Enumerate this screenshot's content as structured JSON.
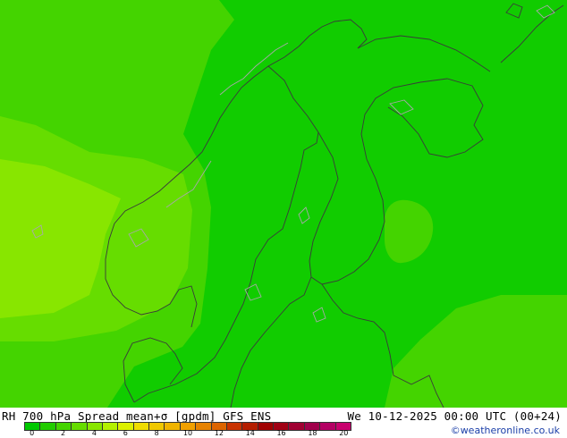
{
  "map": {
    "region": "Scandinavia",
    "background_color": "#11cc00",
    "field_colors": {
      "base": "#11cc00",
      "band_1": "#44d400",
      "band_2": "#66dd00",
      "band_3": "#88e600"
    },
    "coastline_color": "#3a3a3a",
    "lakes_color": "#a8a8a8"
  },
  "footer": {
    "title_left": "RH 700 hPa Spread mean+σ [gpdm] GFS ENS",
    "title_right": "We 10-12-2025 00:00 UTC (00+24)",
    "credit": "©weatheronline.co.uk"
  },
  "legend": {
    "colors": [
      "#00c800",
      "#22cc00",
      "#44d400",
      "#66dd00",
      "#88e600",
      "#b4f000",
      "#dcf000",
      "#f0dc00",
      "#f0c800",
      "#f0b400",
      "#f0a000",
      "#e68200",
      "#dc6400",
      "#c83200",
      "#b41e00",
      "#a00000",
      "#a00014",
      "#a00032",
      "#a0004b",
      "#b40064",
      "#c8006e"
    ],
    "tick_labels": [
      "0",
      "2",
      "4",
      "6",
      "8",
      "10",
      "12",
      "14",
      "16",
      "18",
      "20"
    ]
  }
}
